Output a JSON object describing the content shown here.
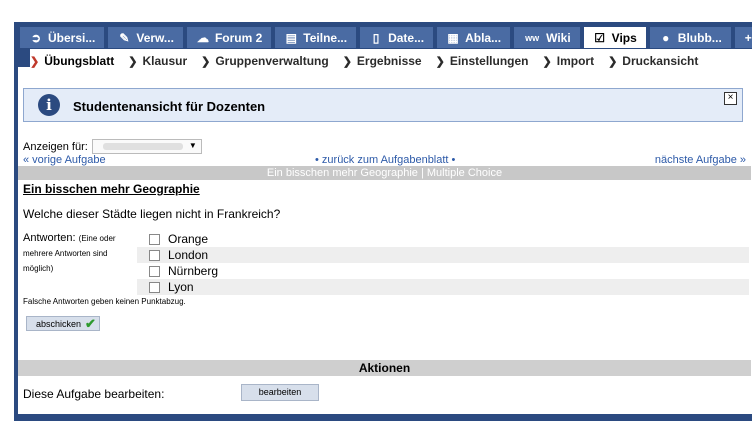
{
  "tabs": [
    {
      "label": "Übersi...",
      "icon": "compass-icon",
      "glyph": "➲"
    },
    {
      "label": "Verw...",
      "icon": "wrench-icon",
      "glyph": "✎"
    },
    {
      "label": "Forum 2",
      "icon": "speech-bubble-icon",
      "glyph": "☁"
    },
    {
      "label": "Teilne...",
      "icon": "participants-icon",
      "glyph": "▤"
    },
    {
      "label": "Date...",
      "icon": "files-icon",
      "glyph": "▯"
    },
    {
      "label": "Abla...",
      "icon": "calendar-icon",
      "glyph": "▦"
    },
    {
      "label": "Wiki",
      "icon": "wiki-icon",
      "glyph": "ww"
    },
    {
      "label": "Vips",
      "icon": "checkbox-icon",
      "glyph": "☑"
    },
    {
      "label": "Blubb...",
      "icon": "blubber-icon",
      "glyph": "●"
    },
    {
      "label": "+",
      "icon": "plus-icon",
      "glyph": ""
    }
  ],
  "subnav": [
    "Übungsblatt",
    "Klausur",
    "Gruppenverwaltung",
    "Ergebnisse",
    "Einstellungen",
    "Import",
    "Druckansicht"
  ],
  "info": {
    "text": "Studentenansicht für Dozenten",
    "close": "×"
  },
  "show_for": {
    "label": "Anzeigen für:"
  },
  "nav": {
    "prev": "« vorige Aufgabe",
    "back": "• zurück zum Aufgabenblatt •",
    "next": "nächste Aufgabe »"
  },
  "task_header": "Ein bisschen mehr Geographie | Multiple Choice",
  "question": {
    "title": "Ein bisschen mehr Geographie",
    "text": "Welche dieser Städte liegen nicht in Frankreich?"
  },
  "answers_label": {
    "main": "Antworten:",
    "note": "(Eine oder mehrere Antworten sind möglich)"
  },
  "answers": [
    "Orange",
    "London",
    "Nürnberg",
    "Lyon"
  ],
  "hint": "Falsche Antworten geben keinen Punktabzug.",
  "submit_label": "abschicken",
  "actions_header": "Aktionen",
  "edit": {
    "label": "Diese Aufgabe bearbeiten:",
    "button": "bearbeiten"
  }
}
